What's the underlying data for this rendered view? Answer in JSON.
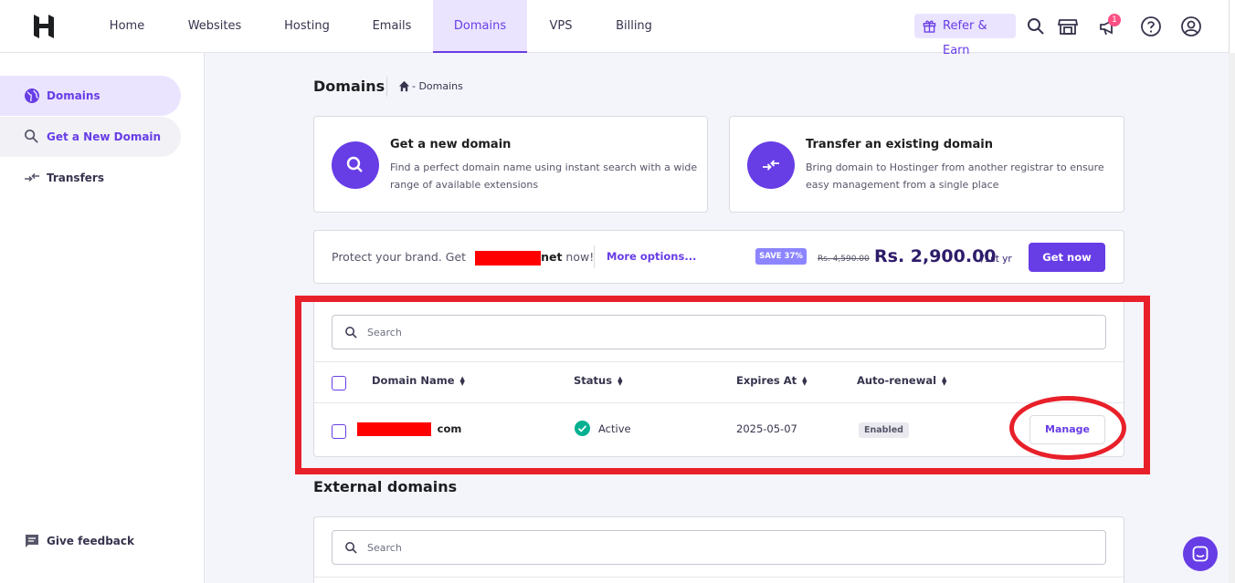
{
  "nav": {
    "items": [
      "Home",
      "Websites",
      "Hosting",
      "Emails",
      "Domains",
      "VPS",
      "Billing"
    ],
    "active": "Domains",
    "refer_label": "Refer & Earn",
    "notification_count": "1"
  },
  "sidebar": {
    "items": [
      {
        "label": "Domains",
        "icon": "globe-icon"
      },
      {
        "label": "Get a New Domain",
        "icon": "search-icon"
      },
      {
        "label": "Transfers",
        "icon": "transfer-icon"
      }
    ],
    "feedback_label": "Give feedback"
  },
  "page": {
    "title": "Domains",
    "breadcrumb": "- Domains"
  },
  "cards": [
    {
      "title": "Get a new domain",
      "desc": "Find a perfect domain name using instant search with a wide range of available extensions",
      "icon": "search-icon"
    },
    {
      "title": "Transfer an existing domain",
      "desc": "Bring domain to Hostinger from another registrar to ensure easy management from a single place",
      "icon": "transfer-icon"
    }
  ],
  "promo": {
    "prefix": "Protect your brand. Get",
    "tld": "net",
    "suffix": "now!",
    "more_options": "More options...",
    "save_tag": "SAVE 37%",
    "old_price": "Rs. 4,590.00",
    "new_price": "Rs. 2,900.00",
    "period": "/1st yr",
    "cta": "Get now"
  },
  "domains_table": {
    "search_placeholder": "Search",
    "columns": [
      "Domain Name",
      "Status",
      "Expires At",
      "Auto-renewal"
    ],
    "rows": [
      {
        "domain_suffix": "com",
        "status": "Active",
        "expires": "2025-05-07",
        "auto_renewal": "Enabled",
        "action": "Manage"
      }
    ]
  },
  "external": {
    "title": "External domains",
    "search_placeholder": "Search"
  },
  "colors": {
    "accent": "#673de6",
    "annotation": "#e8202a",
    "redaction": "#ff0000",
    "active_status": "#00b090"
  }
}
